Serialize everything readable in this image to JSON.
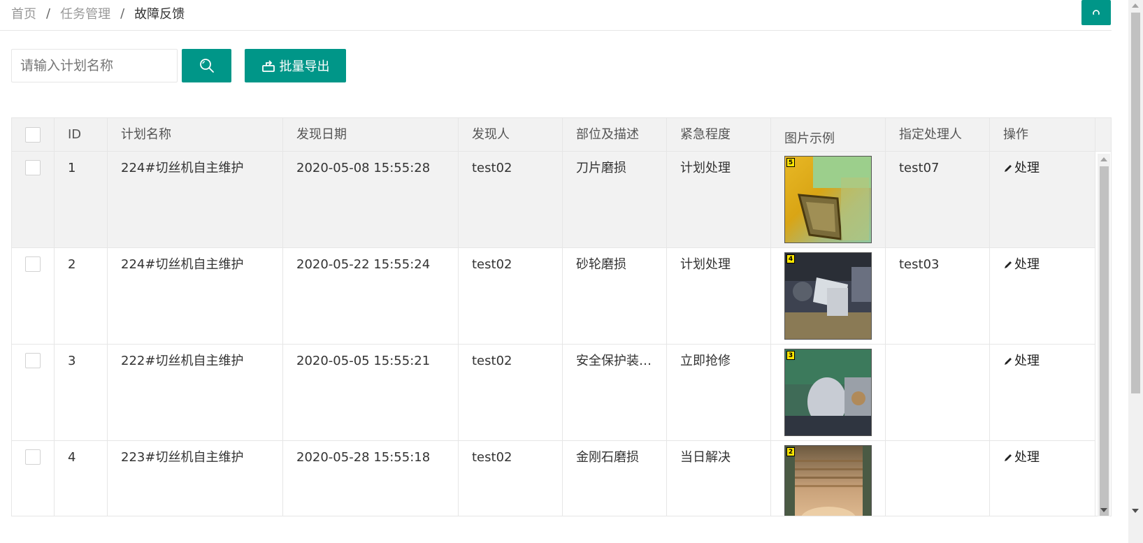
{
  "breadcrumb": {
    "items": [
      "首页",
      "任务管理"
    ],
    "current": "故障反馈",
    "separator": "/"
  },
  "header": {
    "refresh_icon": "refresh-icon"
  },
  "toolbar": {
    "search_placeholder": "请输入计划名称",
    "search_value": "",
    "search_icon": "search-icon",
    "export_label": "批量导出",
    "export_icon": "export-icon"
  },
  "colors": {
    "accent": "#009688",
    "header_bg": "#f2f2f2",
    "border": "#e6e6e6",
    "row_highlight": "#f2f2f2"
  },
  "table": {
    "columns": [
      "ID",
      "计划名称",
      "发现日期",
      "发现人",
      "部位及描述",
      "紧急程度",
      "图片示例",
      "指定处理人",
      "操作"
    ],
    "rows": [
      {
        "id": "1",
        "plan": "224#切丝机自主维护",
        "date": "2020-05-08 15:55:28",
        "finder": "test02",
        "desc": "刀片磨损",
        "urgency": "计划处理",
        "image_label": "5",
        "assignee": "test07",
        "action": "处理"
      },
      {
        "id": "2",
        "plan": "224#切丝机自主维护",
        "date": "2020-05-22 15:55:24",
        "finder": "test02",
        "desc": "砂轮磨损",
        "urgency": "计划处理",
        "image_label": "4",
        "assignee": "test03",
        "action": "处理"
      },
      {
        "id": "3",
        "plan": "222#切丝机自主维护",
        "date": "2020-05-05 15:55:21",
        "finder": "test02",
        "desc": "安全保护装…",
        "urgency": "立即抢修",
        "image_label": "3",
        "assignee": "",
        "action": "处理"
      },
      {
        "id": "4",
        "plan": "223#切丝机自主维护",
        "date": "2020-05-28 15:55:18",
        "finder": "test02",
        "desc": "金刚石磨损",
        "urgency": "当日解决",
        "image_label": "2",
        "assignee": "",
        "action": "处理"
      }
    ]
  }
}
